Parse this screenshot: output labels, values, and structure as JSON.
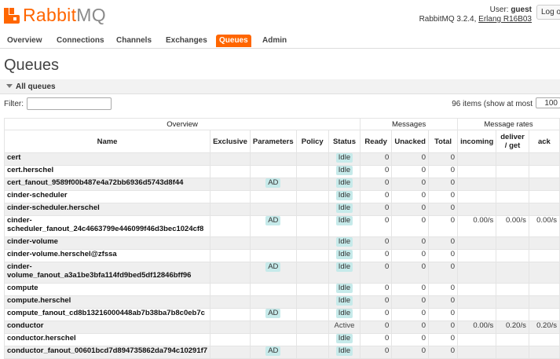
{
  "header": {
    "logo_main": "Rabbit",
    "logo_accent": "MQ",
    "user_prefix": "User: ",
    "user_name": "guest",
    "version_text": "RabbitMQ 3.2.4, ",
    "erlang_link": "Erlang R16B03",
    "logout_label": "Log out"
  },
  "tabs": [
    "Overview",
    "Connections",
    "Channels",
    "Exchanges",
    "Queues",
    "Admin"
  ],
  "active_tab": "Queues",
  "page_title": "Queues",
  "section_label": "All queues",
  "filter": {
    "label": "Filter:",
    "value": ""
  },
  "items_info": "96 items (show at most",
  "page_size": "100",
  "table": {
    "groups": [
      "Overview",
      "Messages",
      "Message rates"
    ],
    "columns": [
      "Name",
      "Exclusive",
      "Parameters",
      "Policy",
      "Status",
      "Ready",
      "Unacked",
      "Total",
      "incoming",
      "deliver / get",
      "ack"
    ],
    "rows": [
      {
        "name": "cert",
        "exclusive": "",
        "params": "",
        "policy": "",
        "status": "Idle",
        "ready": "0",
        "unacked": "0",
        "total": "0",
        "incoming": "",
        "deliver": "",
        "ack": ""
      },
      {
        "name": "cert.herschel",
        "exclusive": "",
        "params": "",
        "policy": "",
        "status": "Idle",
        "ready": "0",
        "unacked": "0",
        "total": "0",
        "incoming": "",
        "deliver": "",
        "ack": ""
      },
      {
        "name": "cert_fanout_9589f00b487e4a72bb6936d5743d8f44",
        "exclusive": "",
        "params": "AD",
        "policy": "",
        "status": "Idle",
        "ready": "0",
        "unacked": "0",
        "total": "0",
        "incoming": "",
        "deliver": "",
        "ack": ""
      },
      {
        "name": "cinder-scheduler",
        "exclusive": "",
        "params": "",
        "policy": "",
        "status": "Idle",
        "ready": "0",
        "unacked": "0",
        "total": "0",
        "incoming": "",
        "deliver": "",
        "ack": ""
      },
      {
        "name": "cinder-scheduler.herschel",
        "exclusive": "",
        "params": "",
        "policy": "",
        "status": "Idle",
        "ready": "0",
        "unacked": "0",
        "total": "0",
        "incoming": "",
        "deliver": "",
        "ack": ""
      },
      {
        "name": "cinder-scheduler_fanout_24c4663799e446099f46d3bec1024cf8",
        "exclusive": "",
        "params": "AD",
        "policy": "",
        "status": "Idle",
        "ready": "0",
        "unacked": "0",
        "total": "0",
        "incoming": "0.00/s",
        "deliver": "0.00/s",
        "ack": "0.00/s"
      },
      {
        "name": "cinder-volume",
        "exclusive": "",
        "params": "",
        "policy": "",
        "status": "Idle",
        "ready": "0",
        "unacked": "0",
        "total": "0",
        "incoming": "",
        "deliver": "",
        "ack": ""
      },
      {
        "name": "cinder-volume.herschel@zfssa",
        "exclusive": "",
        "params": "",
        "policy": "",
        "status": "Idle",
        "ready": "0",
        "unacked": "0",
        "total": "0",
        "incoming": "",
        "deliver": "",
        "ack": ""
      },
      {
        "name": "cinder-volume_fanout_a3a1be3bfa114fd9bed5df12846bff96",
        "exclusive": "",
        "params": "AD",
        "policy": "",
        "status": "Idle",
        "ready": "0",
        "unacked": "0",
        "total": "0",
        "incoming": "",
        "deliver": "",
        "ack": ""
      },
      {
        "name": "compute",
        "exclusive": "",
        "params": "",
        "policy": "",
        "status": "Idle",
        "ready": "0",
        "unacked": "0",
        "total": "0",
        "incoming": "",
        "deliver": "",
        "ack": ""
      },
      {
        "name": "compute.herschel",
        "exclusive": "",
        "params": "",
        "policy": "",
        "status": "Idle",
        "ready": "0",
        "unacked": "0",
        "total": "0",
        "incoming": "",
        "deliver": "",
        "ack": ""
      },
      {
        "name": "compute_fanout_cd8b13216000448ab7b38ba7b8c0eb7c",
        "exclusive": "",
        "params": "AD",
        "policy": "",
        "status": "Idle",
        "ready": "0",
        "unacked": "0",
        "total": "0",
        "incoming": "",
        "deliver": "",
        "ack": ""
      },
      {
        "name": "conductor",
        "exclusive": "",
        "params": "",
        "policy": "",
        "status": "Active",
        "ready": "0",
        "unacked": "0",
        "total": "0",
        "incoming": "0.00/s",
        "deliver": "0.20/s",
        "ack": "0.20/s"
      },
      {
        "name": "conductor.herschel",
        "exclusive": "",
        "params": "",
        "policy": "",
        "status": "Idle",
        "ready": "0",
        "unacked": "0",
        "total": "0",
        "incoming": "",
        "deliver": "",
        "ack": ""
      },
      {
        "name": "conductor_fanout_00601bcd7d894735862da794c10291f7",
        "exclusive": "",
        "params": "AD",
        "policy": "",
        "status": "Idle",
        "ready": "0",
        "unacked": "0",
        "total": "0",
        "incoming": "",
        "deliver": "",
        "ack": ""
      }
    ]
  },
  "colors": {
    "brand": "#ff6600",
    "badge": "#c6eaea",
    "row_alt": "#efefef"
  }
}
